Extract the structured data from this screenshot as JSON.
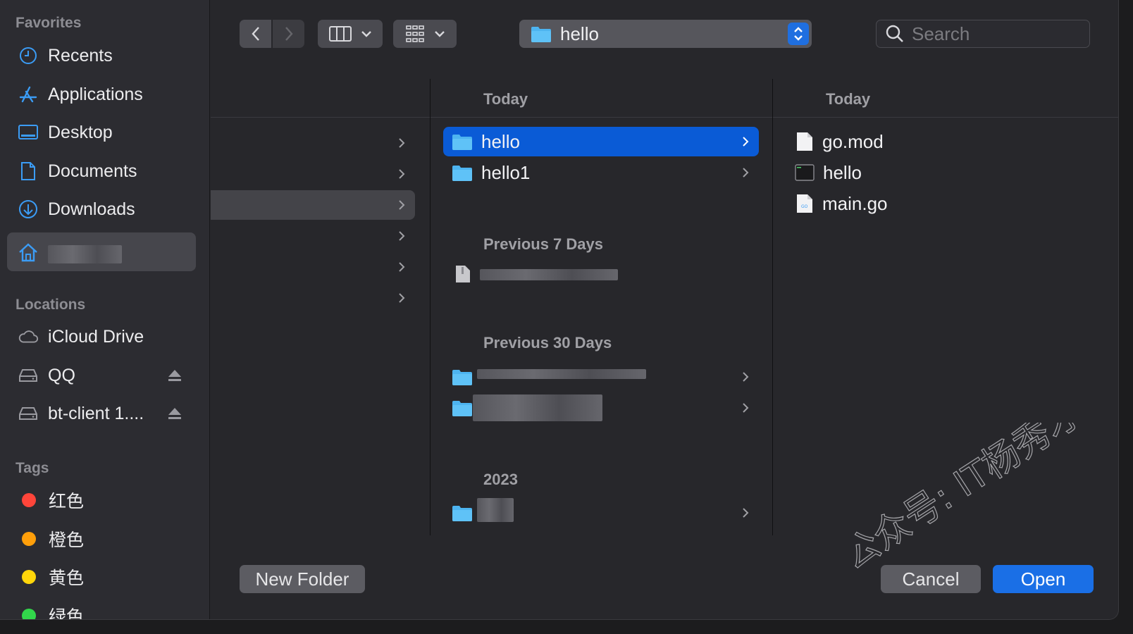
{
  "sidebar": {
    "favorites_header": "Favorites",
    "favorites": [
      {
        "label": "Recents",
        "icon": "clock-icon"
      },
      {
        "label": "Applications",
        "icon": "applications-icon"
      },
      {
        "label": "Desktop",
        "icon": "desktop-icon"
      },
      {
        "label": "Documents",
        "icon": "document-icon"
      },
      {
        "label": "Downloads",
        "icon": "downloads-icon"
      },
      {
        "label": "",
        "icon": "home-icon",
        "selected": true
      }
    ],
    "locations_header": "Locations",
    "locations": [
      {
        "label": "iCloud Drive",
        "icon": "cloud-icon"
      },
      {
        "label": "QQ",
        "icon": "drive-icon",
        "eject": true
      },
      {
        "label": "bt-client 1....",
        "icon": "drive-icon",
        "eject": true
      }
    ],
    "tags_header": "Tags",
    "tags": [
      {
        "label": "红色",
        "color": "#ff453a"
      },
      {
        "label": "橙色",
        "color": "#ff9f0a"
      },
      {
        "label": "黄色",
        "color": "#ffd60a"
      },
      {
        "label": "绿色",
        "color": "#32d74b"
      }
    ]
  },
  "toolbar": {
    "path_label": "hello",
    "search_placeholder": "Search"
  },
  "column2": {
    "today_header": "Today",
    "today_items": [
      {
        "label": "hello",
        "selected": true
      },
      {
        "label": "hello1",
        "selected": false
      }
    ],
    "prev7_header": "Previous 7 Days",
    "prev30_header": "Previous 30 Days",
    "year_header": "2023"
  },
  "column3": {
    "header": "Today",
    "files": [
      {
        "label": "go.mod",
        "icon": "text-file-icon"
      },
      {
        "label": "hello",
        "icon": "executable-icon"
      },
      {
        "label": "main.go",
        "icon": "go-file-icon"
      }
    ]
  },
  "buttons": {
    "new_folder": "New Folder",
    "cancel": "Cancel",
    "open": "Open"
  },
  "colors": {
    "accent": "#0a5bd6",
    "folder": "#4db4f0"
  },
  "watermark": "公众号: IT杨秀才"
}
